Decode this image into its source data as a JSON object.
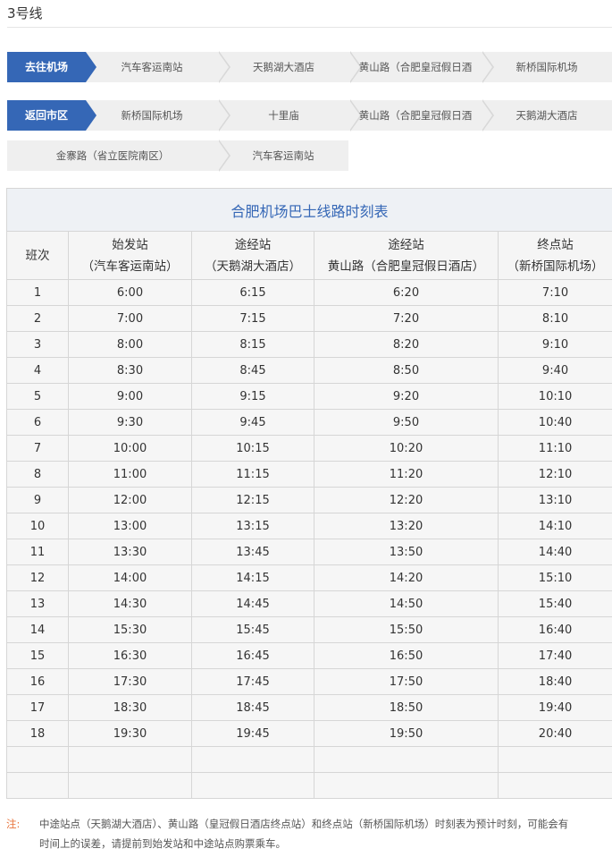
{
  "line_title": "3号线",
  "routes": [
    {
      "direction": "去往机场",
      "stops": [
        "汽车客运南站",
        "天鹅湖大酒店",
        "黄山路（合肥皇冠假日酒",
        "新桥国际机场"
      ]
    },
    {
      "direction": "返回市区",
      "stops": [
        "新桥国际机场",
        "十里庙",
        "黄山路（合肥皇冠假日酒",
        "天鹅湖大酒店"
      ],
      "stops_row2": [
        "金寨路（省立医院南区）",
        "汽车客运南站"
      ]
    }
  ],
  "timetable": {
    "title": "合肥机场巴士线路时刻表",
    "headers": [
      {
        "line1": "班次",
        "line2": ""
      },
      {
        "line1": "始发站",
        "line2": "（汽车客运南站）"
      },
      {
        "line1": "途经站",
        "line2": "（天鹅湖大酒店）"
      },
      {
        "line1": "途经站",
        "line2": "黄山路（合肥皇冠假日酒店）"
      },
      {
        "line1": "终点站",
        "line2": "（新桥国际机场）"
      }
    ],
    "rows": [
      [
        "1",
        "6:00",
        "6:15",
        "6:20",
        "7:10"
      ],
      [
        "2",
        "7:00",
        "7:15",
        "7:20",
        "8:10"
      ],
      [
        "3",
        "8:00",
        "8:15",
        "8:20",
        "9:10"
      ],
      [
        "4",
        "8:30",
        "8:45",
        "8:50",
        "9:40"
      ],
      [
        "5",
        "9:00",
        "9:15",
        "9:20",
        "10:10"
      ],
      [
        "6",
        "9:30",
        "9:45",
        "9:50",
        "10:40"
      ],
      [
        "7",
        "10:00",
        "10:15",
        "10:20",
        "11:10"
      ],
      [
        "8",
        "11:00",
        "11:15",
        "11:20",
        "12:10"
      ],
      [
        "9",
        "12:00",
        "12:15",
        "12:20",
        "13:10"
      ],
      [
        "10",
        "13:00",
        "13:15",
        "13:20",
        "14:10"
      ],
      [
        "11",
        "13:30",
        "13:45",
        "13:50",
        "14:40"
      ],
      [
        "12",
        "14:00",
        "14:15",
        "14:20",
        "15:10"
      ],
      [
        "13",
        "14:30",
        "14:45",
        "14:50",
        "15:40"
      ],
      [
        "14",
        "15:30",
        "15:45",
        "15:50",
        "16:40"
      ],
      [
        "15",
        "16:30",
        "16:45",
        "16:50",
        "17:40"
      ],
      [
        "16",
        "17:30",
        "17:45",
        "17:50",
        "18:40"
      ],
      [
        "17",
        "18:30",
        "18:45",
        "18:50",
        "19:40"
      ],
      [
        "18",
        "19:30",
        "19:45",
        "19:50",
        "20:40"
      ]
    ]
  },
  "note": {
    "label": "注:",
    "text": "中途站点（天鹅湖大酒店）、黄山路（皇冠假日酒店终点站）和终点站（新桥国际机场）时刻表为预计时刻，可能会有时间上的误差，请提前到始发站和中途站点购票乘车。"
  },
  "colors": {
    "accent": "#3567b6",
    "note_label": "#e8733a",
    "cell_bg": "#f6f6f6",
    "caption_bg": "#eef1f5"
  }
}
